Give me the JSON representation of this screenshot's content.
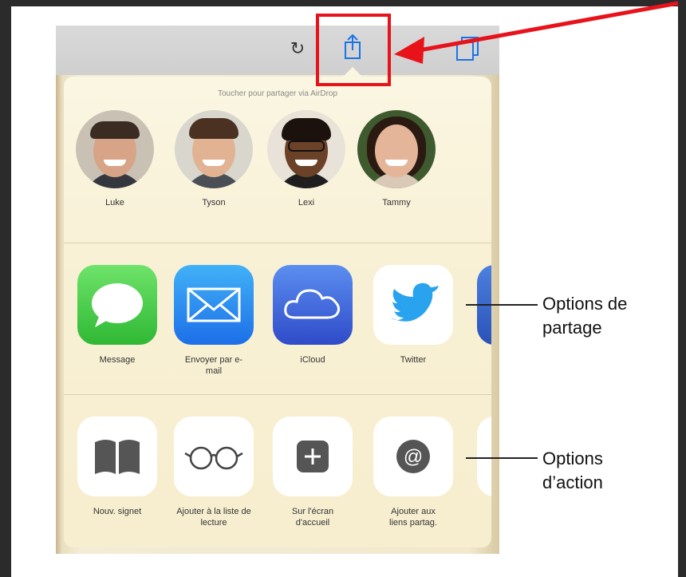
{
  "toolbar": {
    "reload_icon": "reload-icon",
    "share_icon": "share-icon",
    "tabs_icon": "tabs-icon"
  },
  "sheet": {
    "airdrop_title": "Toucher pour partager via AirDrop",
    "people": [
      {
        "name": "Luke"
      },
      {
        "name": "Tyson"
      },
      {
        "name": "Lexi"
      },
      {
        "name": "Tammy"
      }
    ],
    "share_apps": [
      {
        "label": "Message",
        "icon": "message-icon"
      },
      {
        "label": "Envoyer par e-mail",
        "icon": "mail-icon"
      },
      {
        "label": "iCloud",
        "icon": "icloud-icon"
      },
      {
        "label": "Twitter",
        "icon": "twitter-icon"
      }
    ],
    "actions": [
      {
        "label": "Nouv. signet",
        "icon": "bookmark-icon"
      },
      {
        "label": "Ajouter à la liste de lecture",
        "icon": "reading-list-icon"
      },
      {
        "label": "Sur l'écran d'accueil",
        "icon": "add-home-icon"
      },
      {
        "label": "Ajouter aux liens partag.",
        "icon": "shared-links-icon"
      }
    ]
  },
  "callouts": {
    "share_options": "Options de partage",
    "action_options": "Options d’action"
  },
  "colors": {
    "highlight": "#e8121b",
    "message_green": "#4cd964",
    "mail_blue": "#1d7af0",
    "icloud_blue": "#3f63d6",
    "twitter_blue": "#2aa3ef"
  }
}
